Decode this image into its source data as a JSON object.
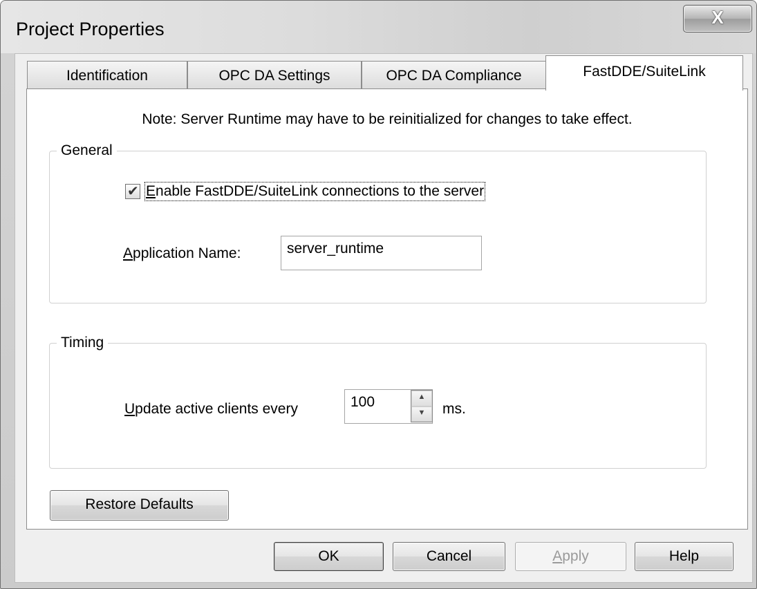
{
  "window": {
    "title": "Project Properties",
    "close_label": "X"
  },
  "tabs": [
    {
      "label": "Identification",
      "active": false
    },
    {
      "label": "OPC DA Settings",
      "active": false
    },
    {
      "label": "OPC DA Compliance",
      "active": false
    },
    {
      "label": "FastDDE/SuiteLink",
      "active": true
    }
  ],
  "note": "Note: Server Runtime may have to be reinitialized for changes to take effect.",
  "general": {
    "legend": "General",
    "enable_checkbox": {
      "checked": true,
      "accel": "E",
      "label_rest": "nable FastDDE/SuiteLink connections to the server"
    },
    "app_name": {
      "accel": "A",
      "label_rest": "pplication Name:",
      "value": "server_runtime"
    }
  },
  "timing": {
    "legend": "Timing",
    "update": {
      "accel": "U",
      "label_rest": "pdate active clients every",
      "value": "100",
      "unit": "ms."
    }
  },
  "restore_defaults_label": "Restore Defaults",
  "footer": {
    "ok": "OK",
    "cancel": "Cancel",
    "apply_accel": "A",
    "apply_rest": "pply",
    "help": "Help"
  }
}
